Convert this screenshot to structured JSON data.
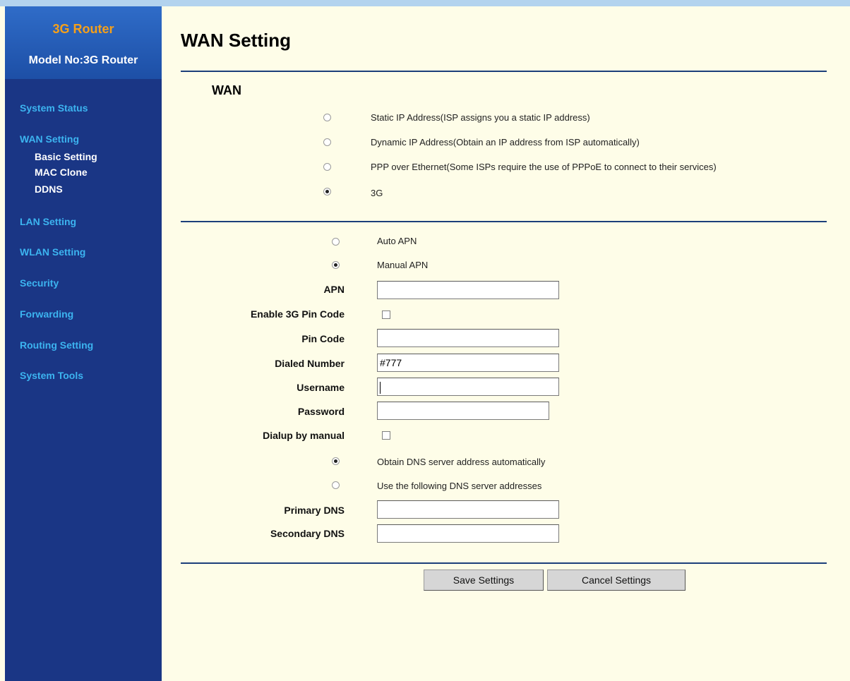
{
  "sidebar": {
    "brand_title": "3G Router",
    "model": "Model No:3G Router",
    "items": {
      "system_status": "System Status",
      "wan_setting": "WAN Setting",
      "basic_setting": "Basic Setting",
      "mac_clone": "MAC Clone",
      "ddns": "DDNS",
      "lan_setting": "LAN Setting",
      "wlan_setting": "WLAN Setting",
      "security": "Security",
      "forwarding": "Forwarding",
      "routing_setting": "Routing Setting",
      "system_tools": "System Tools"
    }
  },
  "page": {
    "title": "WAN Setting",
    "section_title": "WAN"
  },
  "wan_modes": {
    "selected": "3G",
    "static": "Static IP Address(ISP assigns you a static IP address)",
    "dynamic": "Dynamic IP Address(Obtain an IP address from ISP automatically)",
    "pppoe": "PPP over Ethernet(Some ISPs require the use of PPPoE to connect to their services)",
    "g3": "3G"
  },
  "apn": {
    "selected": "Manual APN",
    "auto": "Auto APN",
    "manual": "Manual APN"
  },
  "fields": {
    "apn_label": "APN",
    "apn_value": "",
    "enable_pin_label": "Enable 3G Pin Code",
    "enable_pin_checked": false,
    "pin_label": "Pin Code",
    "pin_value": "",
    "dialed_label": "Dialed Number",
    "dialed_value": "#777",
    "username_label": "Username",
    "username_value": "",
    "password_label": "Password",
    "password_value": "",
    "dialup_label": "Dialup by manual",
    "dialup_checked": false
  },
  "dns": {
    "selected": "auto",
    "auto": "Obtain DNS server address automatically",
    "manual": "Use the following DNS server addresses",
    "primary_label": "Primary DNS",
    "primary_value": "",
    "secondary_label": "Secondary DNS",
    "secondary_value": ""
  },
  "buttons": {
    "save": "Save Settings",
    "cancel": "Cancel Settings"
  }
}
